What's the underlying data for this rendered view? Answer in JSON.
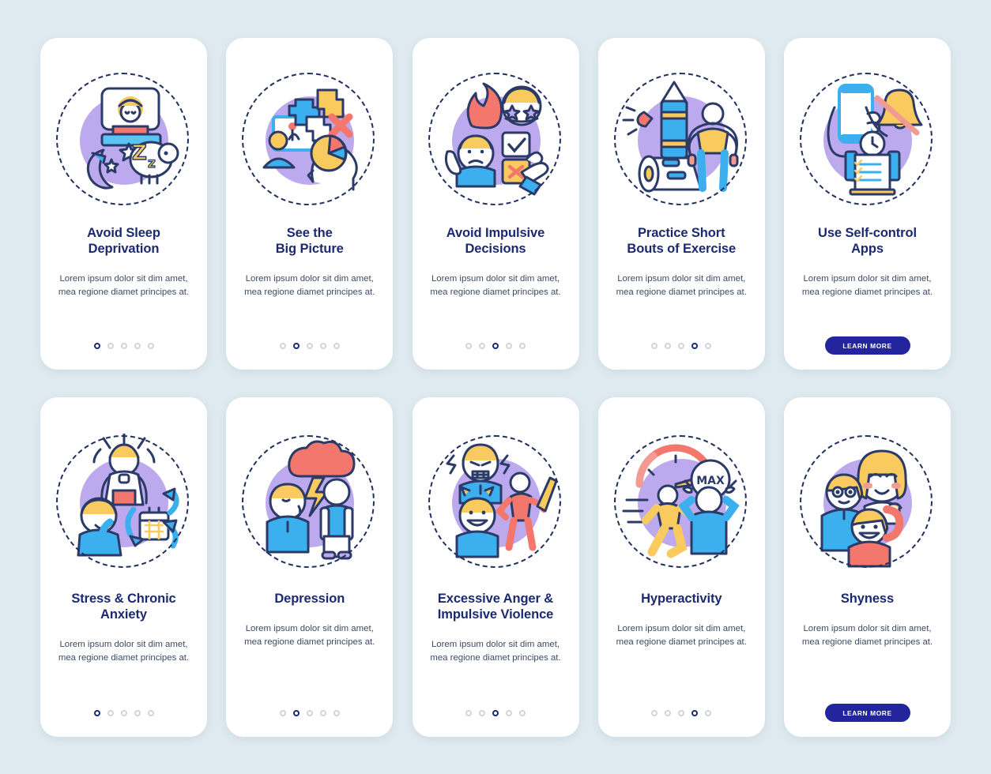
{
  "page": {
    "background_color": "#dfeaf0",
    "card_background": "#ffffff",
    "title_color": "#1b2a70",
    "body_color": "#3c4a63",
    "button_color": "#23259c",
    "dot_active_color": "#1b2a70",
    "dot_inactive_color": "#cfd4de",
    "illustration_circle_color": "#bdaaee",
    "rows": 2,
    "columns": 5
  },
  "cards": [
    {
      "title": "Avoid Sleep\nDeprivation",
      "body": "Lorem ipsum dolor sit dim amet, mea regione diamet principes at.",
      "dots": {
        "count": 5,
        "active_index": 0
      },
      "button": null,
      "illustration": "sleep-deprivation-illustration"
    },
    {
      "title": "See the\nBig Picture",
      "body": "Lorem ipsum dolor sit dim amet, mea regione diamet principes at.",
      "dots": {
        "count": 5,
        "active_index": 1
      },
      "button": null,
      "illustration": "big-picture-illustration"
    },
    {
      "title": "Avoid Impulsive\nDecisions",
      "body": "Lorem ipsum dolor sit dim amet, mea regione diamet principes at.",
      "dots": {
        "count": 5,
        "active_index": 2
      },
      "button": null,
      "illustration": "impulsive-decisions-illustration"
    },
    {
      "title": "Practice Short\nBouts of Exercise",
      "body": "Lorem ipsum dolor sit dim amet, mea regione diamet principes at.",
      "dots": {
        "count": 5,
        "active_index": 3
      },
      "button": null,
      "illustration": "short-exercise-illustration"
    },
    {
      "title": "Use Self-control\nApps",
      "body": "Lorem ipsum dolor sit dim amet, mea regione diamet principes at.",
      "dots": null,
      "button": "LEARN MORE",
      "illustration": "self-control-apps-illustration"
    },
    {
      "title": "Stress & Chronic\nAnxiety",
      "body": "Lorem ipsum dolor sit dim amet, mea regione diamet principes at.",
      "dots": {
        "count": 5,
        "active_index": 0
      },
      "button": null,
      "illustration": "stress-anxiety-illustration"
    },
    {
      "title": "Depression",
      "body": "Lorem ipsum dolor sit dim amet, mea regione diamet principes at.",
      "dots": {
        "count": 5,
        "active_index": 1
      },
      "button": null,
      "illustration": "depression-illustration"
    },
    {
      "title": "Excessive Anger &\nImpulsive Violence",
      "body": "Lorem ipsum dolor sit dim amet, mea regione diamet principes at.",
      "dots": {
        "count": 5,
        "active_index": 2
      },
      "button": null,
      "illustration": "anger-violence-illustration"
    },
    {
      "title": "Hyperactivity",
      "body": "Lorem ipsum dolor sit dim amet, mea regione diamet principes at.",
      "dots": {
        "count": 5,
        "active_index": 3
      },
      "button": null,
      "illustration": "hyperactivity-illustration",
      "illustration_label": "MAX"
    },
    {
      "title": "Shyness",
      "body": "Lorem ipsum dolor sit dim amet, mea regione diamet principes at.",
      "dots": null,
      "button": "LEARN MORE",
      "illustration": "shyness-illustration"
    }
  ]
}
